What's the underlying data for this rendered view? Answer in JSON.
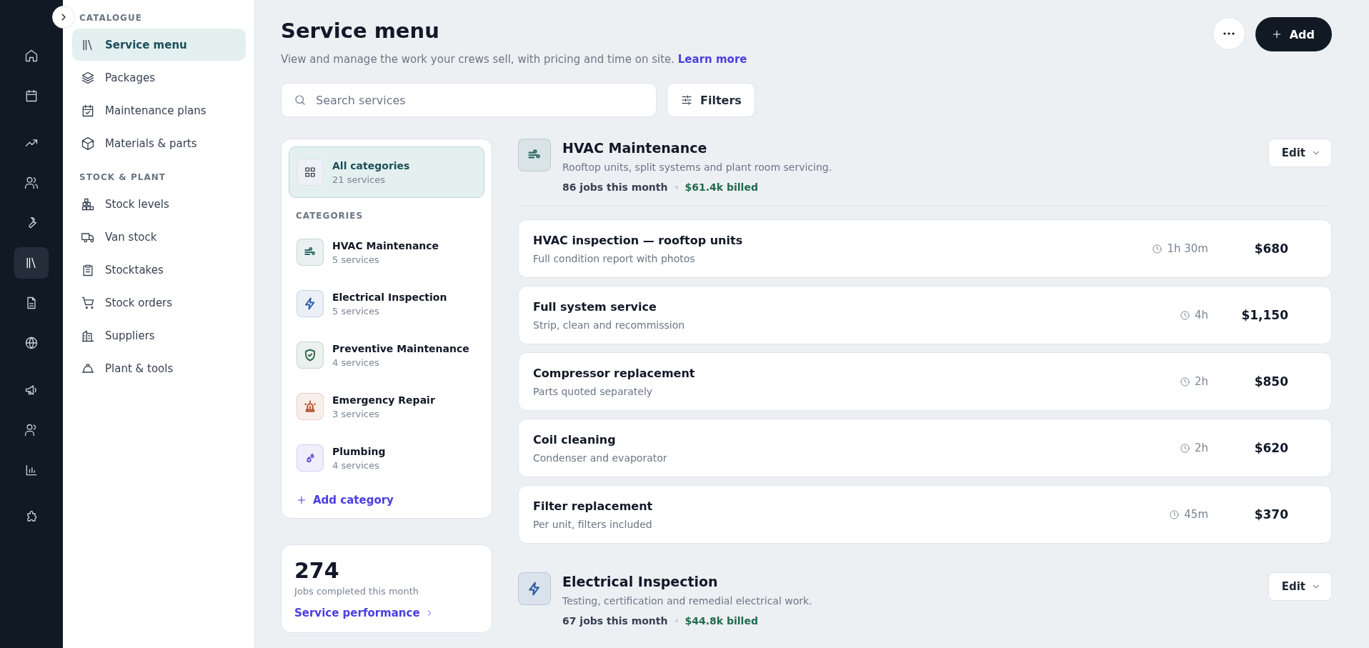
{
  "rail": {
    "items": [
      {
        "selected": false
      },
      {
        "selected": false
      },
      {
        "selected": false
      },
      {
        "selected": false
      },
      {
        "selected": false
      },
      {
        "selected": true
      },
      {
        "selected": false
      },
      {
        "selected": false
      },
      {
        "selected": false
      },
      {
        "selected": false
      },
      {
        "selected": false
      },
      {
        "selected": false
      }
    ]
  },
  "sidebar": {
    "sections": [
      {
        "heading": "CATALOGUE",
        "items": [
          {
            "label": "Service menu",
            "selected": true
          },
          {
            "label": "Packages",
            "selected": false
          },
          {
            "label": "Maintenance plans",
            "selected": false
          },
          {
            "label": "Materials & parts",
            "selected": false
          }
        ]
      },
      {
        "heading": "STOCK & PLANT",
        "items": [
          {
            "label": "Stock levels",
            "selected": false
          },
          {
            "label": "Van stock",
            "selected": false
          },
          {
            "label": "Stocktakes",
            "selected": false
          },
          {
            "label": "Stock orders",
            "selected": false
          },
          {
            "label": "Suppliers",
            "selected": false
          },
          {
            "label": "Plant & tools",
            "selected": false
          }
        ]
      }
    ]
  },
  "header": {
    "title": "Service menu",
    "subtitle": "View and manage the work your crews sell, with pricing and time on site.",
    "link": "Learn more",
    "add": "Add"
  },
  "search": {
    "placeholder": "Search services"
  },
  "filters": "Filters",
  "categories": {
    "all": {
      "label": "All categories",
      "count": "21 services",
      "selected": true
    },
    "heading": "CATEGORIES",
    "items": [
      {
        "label": "HVAC Maintenance",
        "count": "5 services",
        "color": "#2f6b66",
        "selected": false
      },
      {
        "label": "Electrical Inspection",
        "count": "5 services",
        "color": "#2f5ea8",
        "selected": false
      },
      {
        "label": "Preventive Maintenance",
        "count": "4 services",
        "color": "#2f6b4e",
        "selected": false
      },
      {
        "label": "Emergency Repair",
        "count": "3 services",
        "color": "#b4532a",
        "selected": false
      },
      {
        "label": "Plumbing",
        "count": "4 services",
        "color": "#5b4fd8",
        "selected": false
      }
    ],
    "add": "Add category"
  },
  "stats": {
    "value": "274",
    "caption": "Jobs completed this month",
    "link": "Service performance"
  },
  "sections": [
    {
      "title": "HVAC Maintenance",
      "description": "Rooftop units, split systems and plant room servicing.",
      "jobs": "86 jobs this month",
      "billed": "$61.4k billed",
      "edit": "Edit",
      "color": "#2f6b66",
      "services": [
        {
          "name": "HVAC inspection — rooftop units",
          "note": "Full condition report with photos",
          "duration": "1h 30m",
          "price": "$680"
        },
        {
          "name": "Full system service",
          "note": "Strip, clean and recommission",
          "duration": "4h",
          "price": "$1,150"
        },
        {
          "name": "Compressor replacement",
          "note": "Parts quoted separately",
          "duration": "2h",
          "price": "$850"
        },
        {
          "name": "Coil cleaning",
          "note": "Condenser and evaporator",
          "duration": "2h",
          "price": "$620"
        },
        {
          "name": "Filter replacement",
          "note": "Per unit, filters included",
          "duration": "45m",
          "price": "$370"
        }
      ]
    },
    {
      "title": "Electrical Inspection",
      "description": "Testing, certification and remedial electrical work.",
      "jobs": "67 jobs this month",
      "billed": "$44.8k billed",
      "edit": "Edit",
      "color": "#2f5ea8"
    }
  ]
}
